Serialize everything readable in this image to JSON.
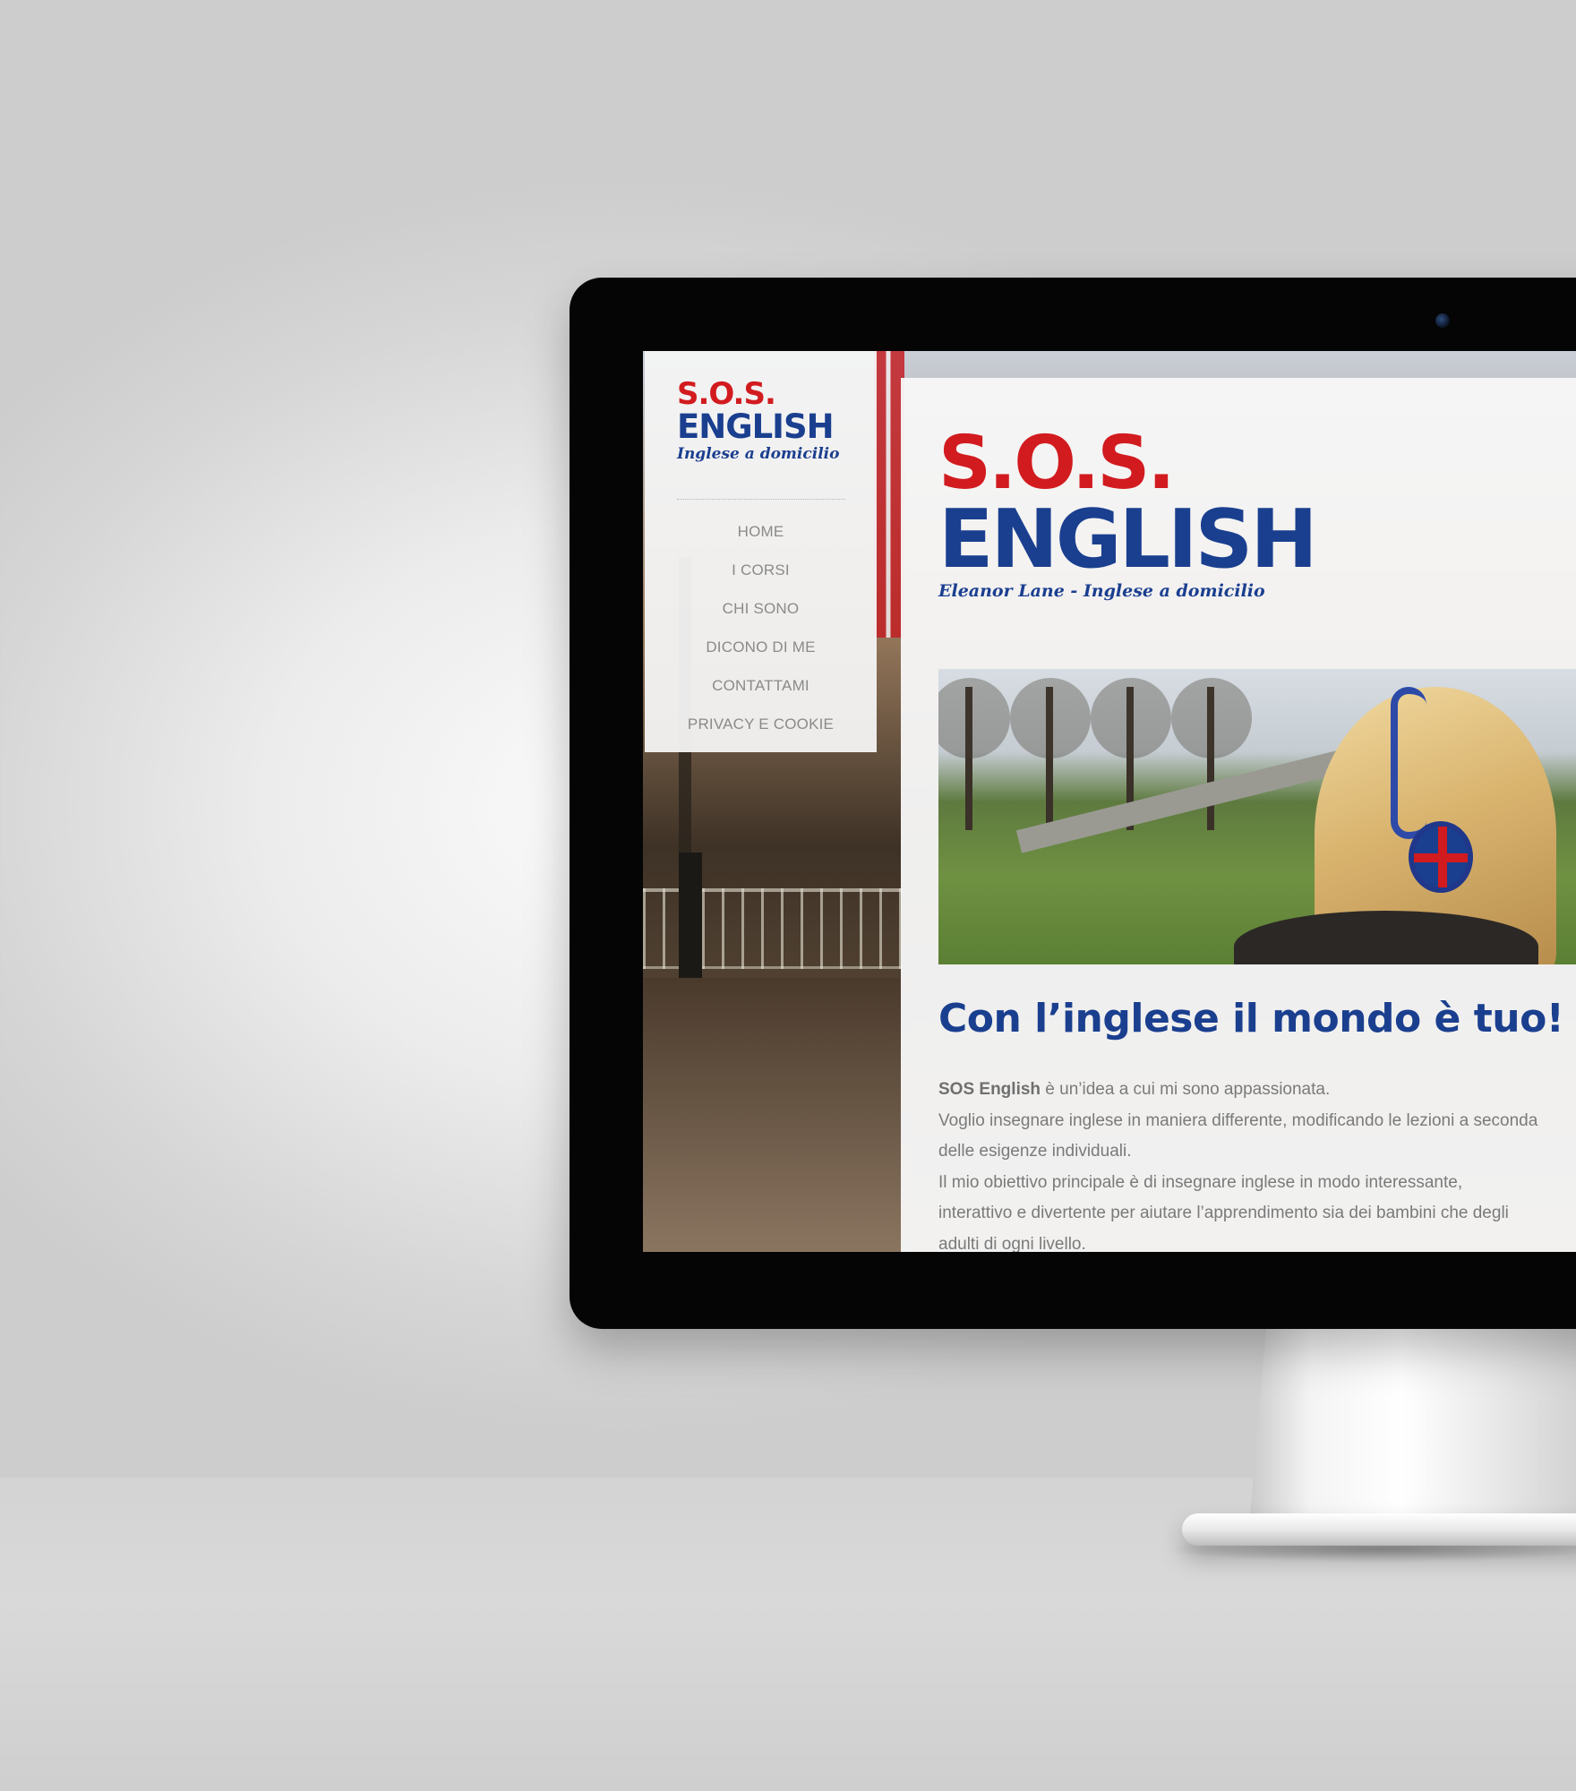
{
  "sidebar": {
    "logo": {
      "top": "S.O.S.",
      "main": "ENGLISH",
      "tagline": "Inglese a domicilio"
    },
    "nav": [
      {
        "label": "HOME"
      },
      {
        "label": "I CORSI"
      },
      {
        "label": "CHI SONO"
      },
      {
        "label": "DICONO DI ME"
      },
      {
        "label": "CONTATTAMI"
      },
      {
        "label": "PRIVACY E COOKIE"
      }
    ]
  },
  "main": {
    "logo": {
      "top": "S.O.S.",
      "main": "ENGLISH",
      "tagline": "Eleanor Lane - Inglese a domicilio"
    },
    "heading": "Con l’inglese il mondo è tuo!",
    "paragraph": {
      "strong": "SOS English",
      "line1_rest": " è un’idea a cui mi sono appassionata.",
      "line2": "Voglio insegnare inglese in maniera differente, modificando le lezioni a seconda",
      "line3": "delle esigenze individuali.",
      "line4": "Il mio obiettivo principale è di insegnare inglese in modo interessante,",
      "line5": "interattivo e divertente per aiutare l’apprendimento sia dei bambini che degli",
      "line6": "adulti di ogni livello."
    }
  },
  "colors": {
    "brand_red": "#d21b1f",
    "brand_blue": "#1a3f8f",
    "nav_text": "#8a8a8a",
    "body_text": "#7a7a7a"
  }
}
